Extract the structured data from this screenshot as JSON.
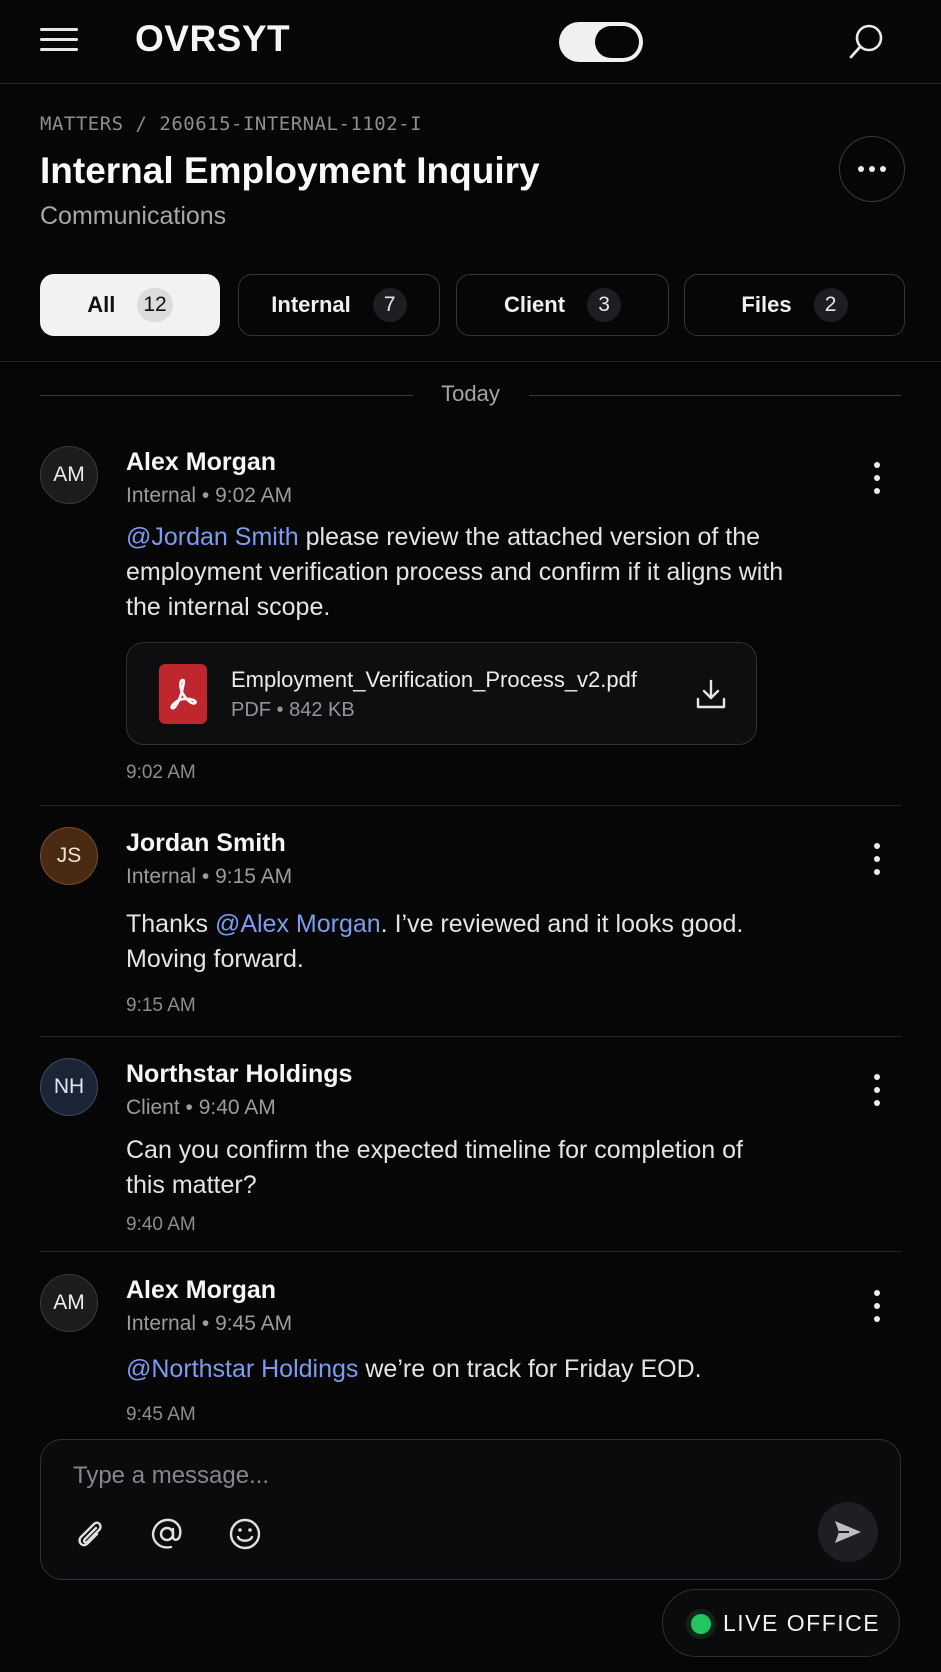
{
  "app": {
    "logo": "OVRSYT"
  },
  "header": {
    "breadcrumb": "MATTERS / 260615-INTERNAL-1102-I",
    "title": "Internal Employment Inquiry",
    "subtitle": "Communications"
  },
  "tabs": [
    {
      "label": "All",
      "count": "12",
      "active": true
    },
    {
      "label": "Internal",
      "count": "7",
      "active": false
    },
    {
      "label": "Client",
      "count": "3",
      "active": false
    },
    {
      "label": "Files",
      "count": "2",
      "active": false
    }
  ],
  "date_separator": "Today",
  "messages": [
    {
      "initials": "AM",
      "sender": "Alex Morgan",
      "meta": "Internal • 9:02 AM",
      "mention": "@Jordan Smith",
      "text_before": "",
      "text_after": " please review the attached version of the employment verification process and confirm if it aligns with the internal scope.",
      "attachment": {
        "name": "Employment_Verification_Process_v2.pdf",
        "meta": "PDF • 842 KB"
      },
      "timestamp": "9:02 AM"
    },
    {
      "initials": "JS",
      "sender": "Jordan Smith",
      "meta": "Internal • 9:15 AM",
      "text_before": "Thanks ",
      "mention": "@Alex Morgan",
      "text_after": ". I’ve reviewed and it looks good. Moving forward.",
      "timestamp": "9:15 AM"
    },
    {
      "initials": "NH",
      "sender": "Northstar Holdings",
      "meta": "Client • 9:40 AM",
      "text": "Can you confirm the expected timeline for completion of this matter?",
      "timestamp": "9:40 AM"
    },
    {
      "initials": "AM",
      "sender": "Alex Morgan",
      "meta": "Internal • 9:45 AM",
      "mention": "@Northstar Holdings",
      "text_after": " we’re on track for Friday EOD.",
      "timestamp": "9:45 AM"
    }
  ],
  "composer": {
    "placeholder": "Type a message..."
  },
  "live_office": {
    "label": "LIVE OFFICE",
    "status_color": "#22c55e"
  },
  "colors": {
    "background": "#060607",
    "mention": "#7d9cf0",
    "pdf": "#c0262d"
  }
}
